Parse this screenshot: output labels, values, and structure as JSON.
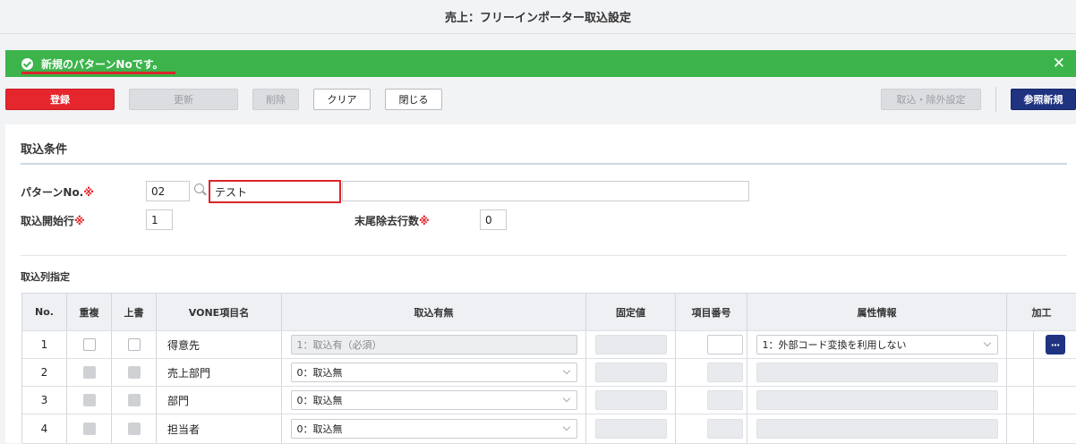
{
  "header": {
    "title": "売上：フリーインポーター取込設定"
  },
  "alert": {
    "message": "新規のパターンNoです。",
    "close": "✕"
  },
  "toolbar": {
    "register": "登録",
    "update": "更新",
    "delete": "削除",
    "clear": "クリア",
    "close": "閉じる",
    "import_exclude": "取込・除外設定",
    "ref_new": "参照新規"
  },
  "section": {
    "title": "取込条件",
    "columns_title": "取込列指定"
  },
  "form": {
    "pattern_label": "パターンNo.",
    "pattern_no": "02",
    "pattern_name": "テスト",
    "start_row_label": "取込開始行",
    "start_row": "1",
    "trailing_label": "末尾除去行数",
    "trailing_rows": "0",
    "required_mark": "※"
  },
  "table": {
    "headers": [
      "No.",
      "重複",
      "上書",
      "VONE項目名",
      "取込有無",
      "固定値",
      "項目番号",
      "属性情報",
      "加工"
    ],
    "rows": [
      {
        "no": "1",
        "name": "得意先",
        "import": "1：取込有（必須）",
        "attr": "1：外部コード変換を利用しない",
        "more": "···"
      },
      {
        "no": "2",
        "name": "売上部門",
        "import": "0：取込無"
      },
      {
        "no": "3",
        "name": "部門",
        "import": "0：取込無"
      },
      {
        "no": "4",
        "name": "担当者",
        "import": "0：取込無"
      }
    ]
  },
  "colors": {
    "alert": "#3cb44b",
    "primary": "#e5262d",
    "navy": "#1f3380",
    "highlight": "#d9262c"
  }
}
